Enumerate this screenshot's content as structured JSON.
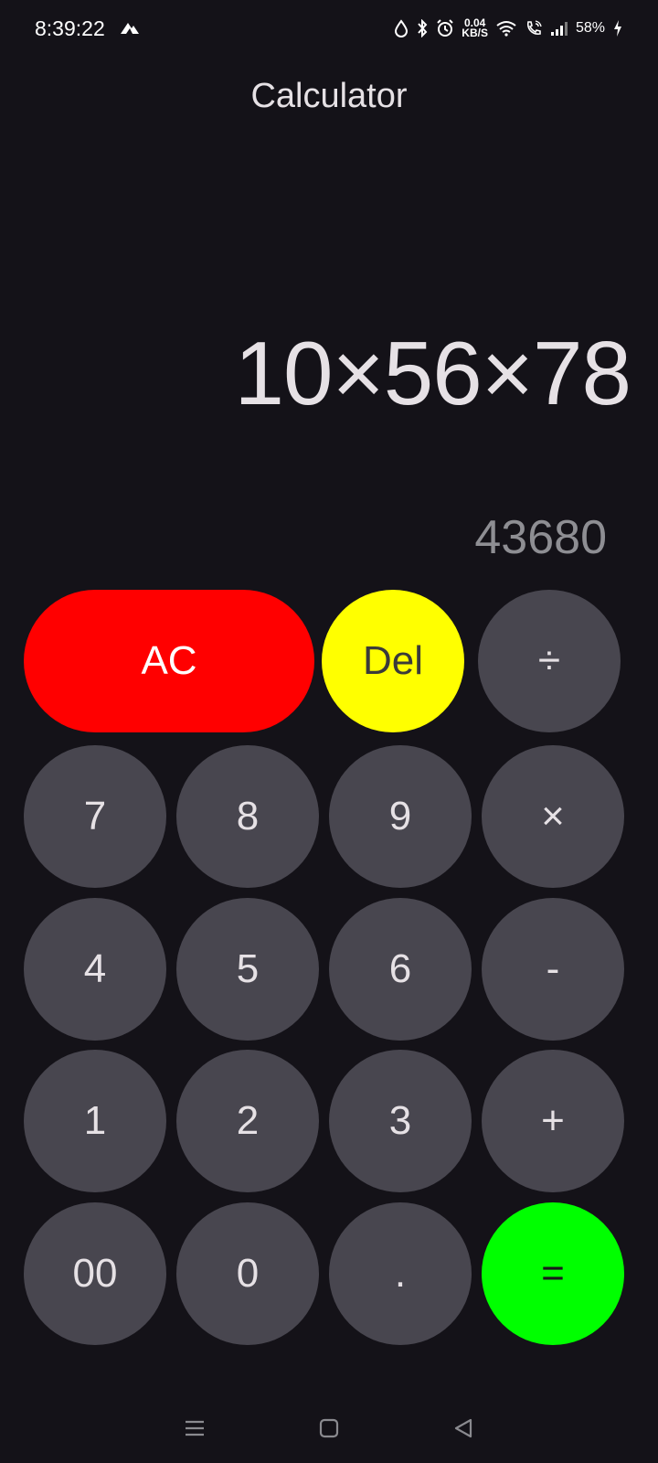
{
  "status_bar": {
    "time": "8:39:22",
    "net_speed_value": "0.04",
    "net_speed_unit": "KB/S",
    "battery_percent": "58%",
    "icons": [
      "mountain-icon",
      "drop-icon",
      "bluetooth-icon",
      "alarm-icon",
      "wifi-icon",
      "wifi-call-icon",
      "signal-icon",
      "charging-icon"
    ]
  },
  "app": {
    "title": "Calculator"
  },
  "display": {
    "expression": "10×56×78",
    "result": "43680"
  },
  "keypad": {
    "ac": "AC",
    "del": "Del",
    "divide": "÷",
    "seven": "7",
    "eight": "8",
    "nine": "9",
    "multiply": "×",
    "four": "4",
    "five": "5",
    "six": "6",
    "minus": "-",
    "one": "1",
    "two": "2",
    "three": "3",
    "plus": "+",
    "double_zero": "00",
    "zero": "0",
    "dot": ".",
    "equals": "="
  },
  "colors": {
    "background": "#141218",
    "key": "#48464f",
    "ac": "#ff0000",
    "del": "#ffff00",
    "equals": "#00ff00"
  },
  "nav_bar": {
    "icons": [
      "menu-icon",
      "home-icon",
      "back-icon"
    ]
  }
}
